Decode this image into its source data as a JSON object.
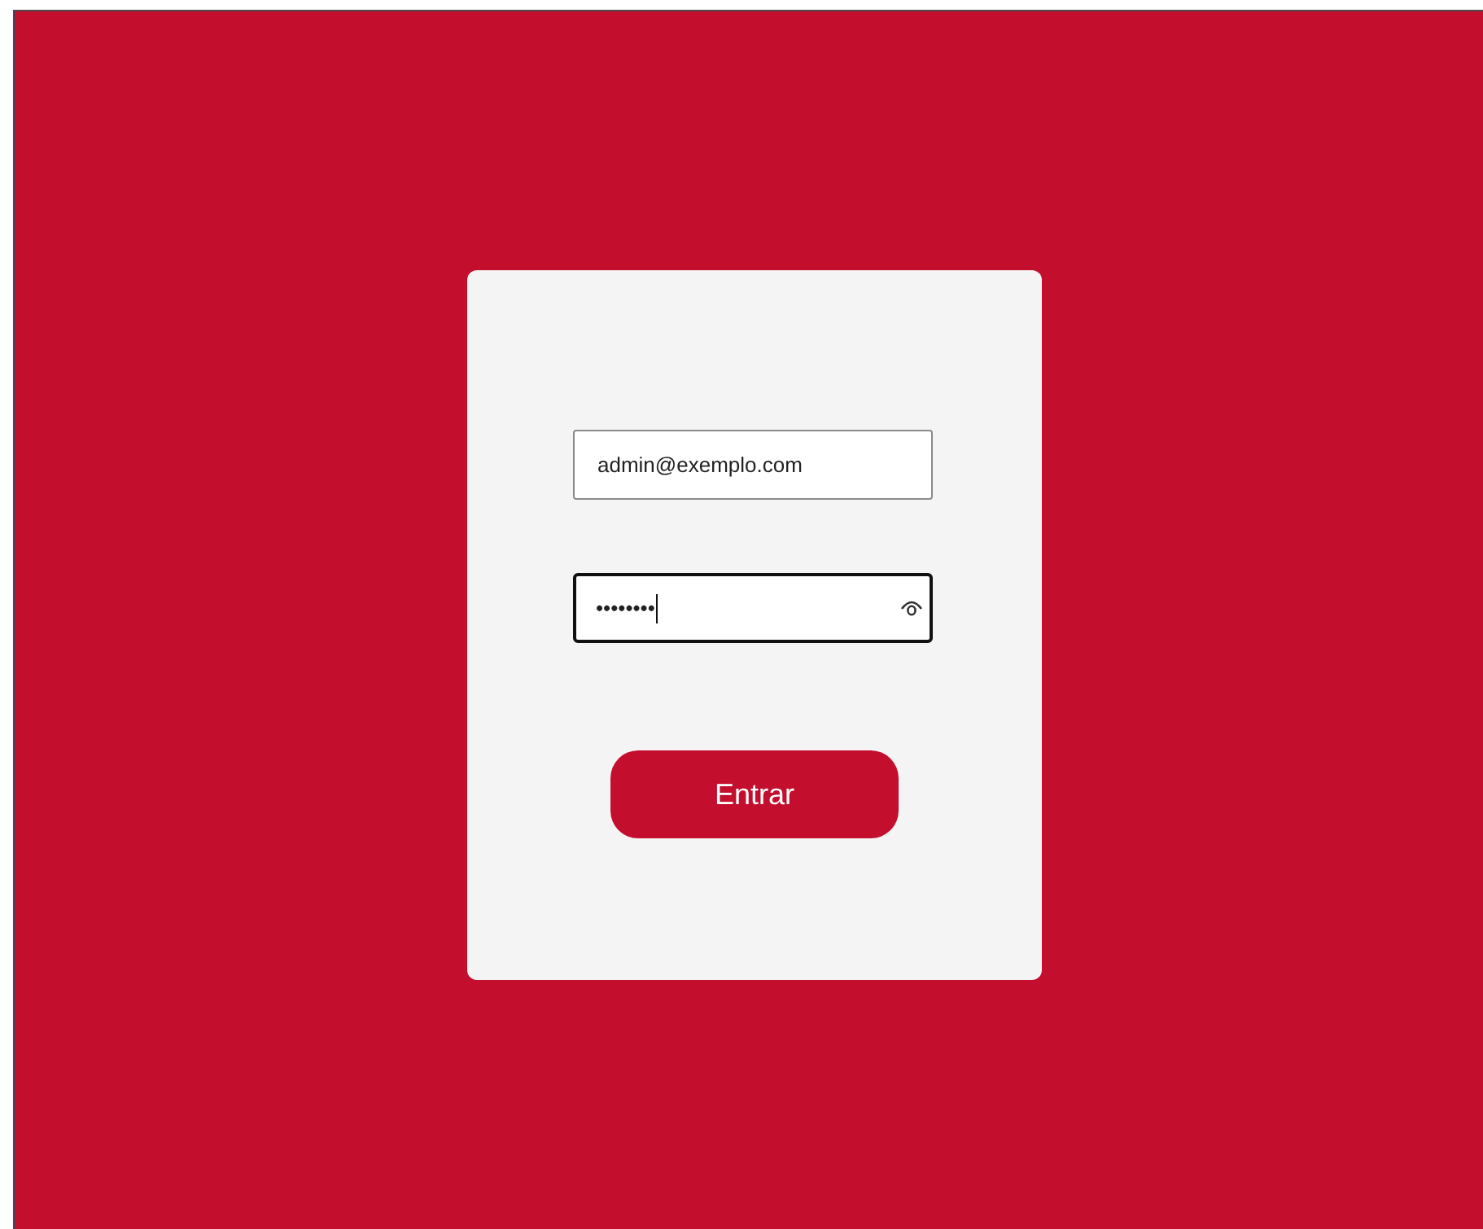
{
  "login_form": {
    "email": {
      "value": "admin@exemplo.com",
      "focused": false
    },
    "password": {
      "value": "••••••••",
      "focused": true
    },
    "button": {
      "label": "Entrar"
    }
  }
}
